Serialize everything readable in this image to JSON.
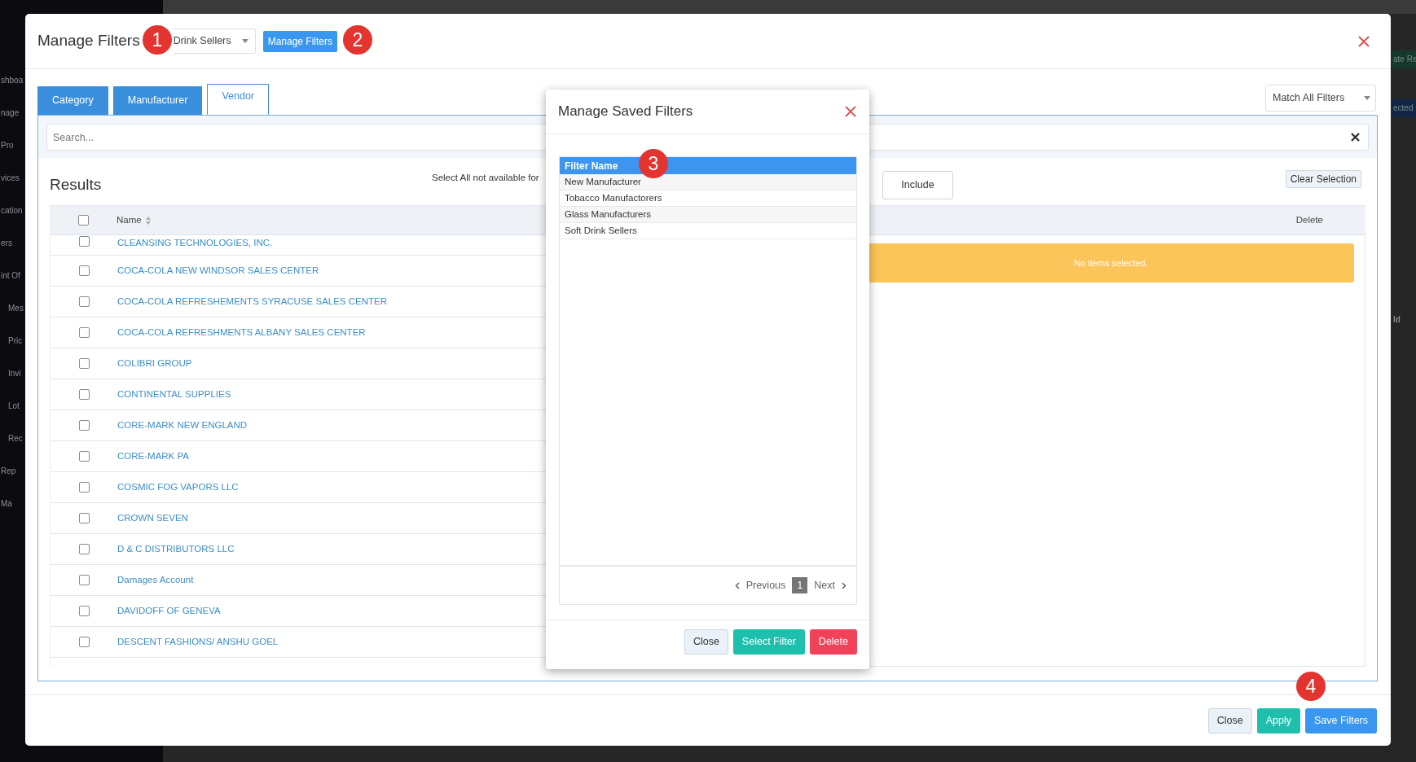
{
  "background": {
    "sidebar_items": [
      "shboa",
      "nage",
      "Pro",
      "vices",
      "cation",
      "ers",
      "int Of",
      "Mes",
      "Pric",
      "Invi",
      "Lot",
      "Rec",
      "Rep",
      "Ma"
    ],
    "right_fragments": [
      {
        "text": "ate Re",
        "kind": "success"
      },
      {
        "text": "ected",
        "kind": "primary"
      },
      {
        "text": "ld",
        "kind": "plain"
      }
    ]
  },
  "modal": {
    "title": "Manage Filters",
    "saved_filter_select": {
      "value": "Drink Sellers"
    },
    "manage_button": "Manage Filters",
    "tabs": [
      {
        "label": "Category",
        "selected": false
      },
      {
        "label": "Manufacturer",
        "selected": false
      },
      {
        "label": "Vendor",
        "selected": true
      }
    ],
    "match_select": {
      "value": "Match All Filters"
    },
    "search": {
      "placeholder": "Search..."
    },
    "results": {
      "title": "Results",
      "note": "Select All not available for",
      "column": "Name",
      "select_all_checked": false,
      "rows": [
        {
          "name": "CLEANSING TECHNOLOGIES, INC.",
          "checked": false
        },
        {
          "name": "COCA-COLA NEW WINDSOR SALES CENTER",
          "checked": false
        },
        {
          "name": "COCA-COLA REFRESHEMENTS SYRACUSE SALES CENTER",
          "checked": false
        },
        {
          "name": "COCA-COLA REFRESHMENTS ALBANY SALES CENTER",
          "checked": false
        },
        {
          "name": "COLIBRI GROUP",
          "checked": false
        },
        {
          "name": "CONTINENTAL SUPPLIES",
          "checked": false
        },
        {
          "name": "CORE-MARK NEW ENGLAND",
          "checked": false
        },
        {
          "name": "CORE-MARK PA",
          "checked": false
        },
        {
          "name": "COSMIC FOG VAPORS LLC",
          "checked": false
        },
        {
          "name": "CROWN SEVEN",
          "checked": false
        },
        {
          "name": "D & C DISTRIBUTORS LLC",
          "checked": false
        },
        {
          "name": "Damages Account",
          "checked": false
        },
        {
          "name": "DAVIDOFF OF GENEVA",
          "checked": false
        },
        {
          "name": "DESCENT FASHIONS/ ANSHU GOEL",
          "checked": false
        }
      ]
    },
    "selection": {
      "include_button": "Include",
      "clear_button": "Clear Selection",
      "column": "Delete",
      "empty_message": "No items selected."
    },
    "footer_buttons": [
      {
        "label": "Close",
        "kind": "light"
      },
      {
        "label": "Apply",
        "kind": "teal"
      },
      {
        "label": "Save Filters",
        "kind": "primary"
      }
    ]
  },
  "saved_filters_dialog": {
    "title": "Manage Saved Filters",
    "column": "Filter Name",
    "rows": [
      "New Manufacturer",
      "Tobacco Manufactorers",
      "Glass Manufacturers",
      "Soft Drink Sellers"
    ],
    "pagination": {
      "previous": "Previous",
      "pages": [
        {
          "label": "1",
          "selected": true
        }
      ],
      "next": "Next"
    },
    "buttons": [
      {
        "label": "Close",
        "kind": "light"
      },
      {
        "label": "Select Filter",
        "kind": "teal"
      },
      {
        "label": "Delete",
        "kind": "danger"
      }
    ]
  },
  "callouts": [
    "1",
    "2",
    "3",
    "4"
  ]
}
